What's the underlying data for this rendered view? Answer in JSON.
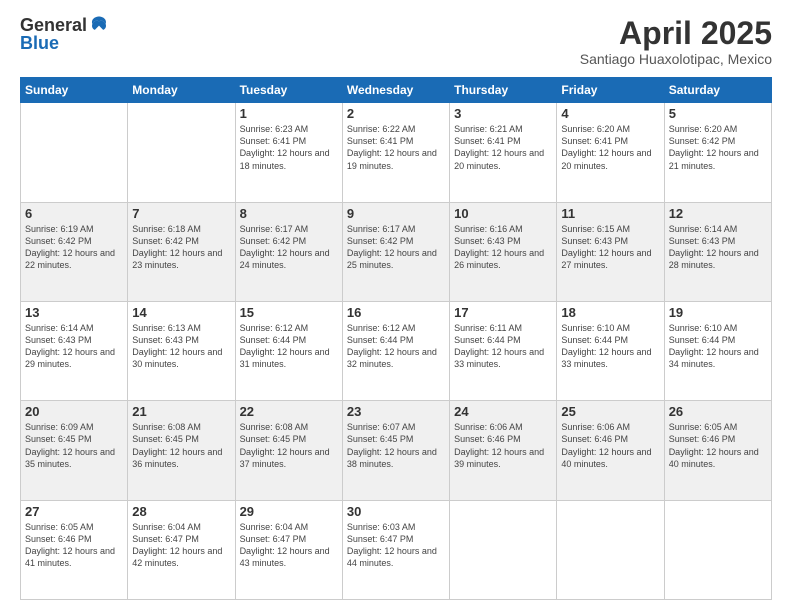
{
  "header": {
    "logo_general": "General",
    "logo_blue": "Blue",
    "month": "April 2025",
    "location": "Santiago Huaxolotipac, Mexico"
  },
  "days_of_week": [
    "Sunday",
    "Monday",
    "Tuesday",
    "Wednesday",
    "Thursday",
    "Friday",
    "Saturday"
  ],
  "weeks": [
    [
      {
        "day": "",
        "sunrise": "",
        "sunset": "",
        "daylight": ""
      },
      {
        "day": "",
        "sunrise": "",
        "sunset": "",
        "daylight": ""
      },
      {
        "day": "1",
        "sunrise": "Sunrise: 6:23 AM",
        "sunset": "Sunset: 6:41 PM",
        "daylight": "Daylight: 12 hours and 18 minutes."
      },
      {
        "day": "2",
        "sunrise": "Sunrise: 6:22 AM",
        "sunset": "Sunset: 6:41 PM",
        "daylight": "Daylight: 12 hours and 19 minutes."
      },
      {
        "day": "3",
        "sunrise": "Sunrise: 6:21 AM",
        "sunset": "Sunset: 6:41 PM",
        "daylight": "Daylight: 12 hours and 20 minutes."
      },
      {
        "day": "4",
        "sunrise": "Sunrise: 6:20 AM",
        "sunset": "Sunset: 6:41 PM",
        "daylight": "Daylight: 12 hours and 20 minutes."
      },
      {
        "day": "5",
        "sunrise": "Sunrise: 6:20 AM",
        "sunset": "Sunset: 6:42 PM",
        "daylight": "Daylight: 12 hours and 21 minutes."
      }
    ],
    [
      {
        "day": "6",
        "sunrise": "Sunrise: 6:19 AM",
        "sunset": "Sunset: 6:42 PM",
        "daylight": "Daylight: 12 hours and 22 minutes."
      },
      {
        "day": "7",
        "sunrise": "Sunrise: 6:18 AM",
        "sunset": "Sunset: 6:42 PM",
        "daylight": "Daylight: 12 hours and 23 minutes."
      },
      {
        "day": "8",
        "sunrise": "Sunrise: 6:17 AM",
        "sunset": "Sunset: 6:42 PM",
        "daylight": "Daylight: 12 hours and 24 minutes."
      },
      {
        "day": "9",
        "sunrise": "Sunrise: 6:17 AM",
        "sunset": "Sunset: 6:42 PM",
        "daylight": "Daylight: 12 hours and 25 minutes."
      },
      {
        "day": "10",
        "sunrise": "Sunrise: 6:16 AM",
        "sunset": "Sunset: 6:43 PM",
        "daylight": "Daylight: 12 hours and 26 minutes."
      },
      {
        "day": "11",
        "sunrise": "Sunrise: 6:15 AM",
        "sunset": "Sunset: 6:43 PM",
        "daylight": "Daylight: 12 hours and 27 minutes."
      },
      {
        "day": "12",
        "sunrise": "Sunrise: 6:14 AM",
        "sunset": "Sunset: 6:43 PM",
        "daylight": "Daylight: 12 hours and 28 minutes."
      }
    ],
    [
      {
        "day": "13",
        "sunrise": "Sunrise: 6:14 AM",
        "sunset": "Sunset: 6:43 PM",
        "daylight": "Daylight: 12 hours and 29 minutes."
      },
      {
        "day": "14",
        "sunrise": "Sunrise: 6:13 AM",
        "sunset": "Sunset: 6:43 PM",
        "daylight": "Daylight: 12 hours and 30 minutes."
      },
      {
        "day": "15",
        "sunrise": "Sunrise: 6:12 AM",
        "sunset": "Sunset: 6:44 PM",
        "daylight": "Daylight: 12 hours and 31 minutes."
      },
      {
        "day": "16",
        "sunrise": "Sunrise: 6:12 AM",
        "sunset": "Sunset: 6:44 PM",
        "daylight": "Daylight: 12 hours and 32 minutes."
      },
      {
        "day": "17",
        "sunrise": "Sunrise: 6:11 AM",
        "sunset": "Sunset: 6:44 PM",
        "daylight": "Daylight: 12 hours and 33 minutes."
      },
      {
        "day": "18",
        "sunrise": "Sunrise: 6:10 AM",
        "sunset": "Sunset: 6:44 PM",
        "daylight": "Daylight: 12 hours and 33 minutes."
      },
      {
        "day": "19",
        "sunrise": "Sunrise: 6:10 AM",
        "sunset": "Sunset: 6:44 PM",
        "daylight": "Daylight: 12 hours and 34 minutes."
      }
    ],
    [
      {
        "day": "20",
        "sunrise": "Sunrise: 6:09 AM",
        "sunset": "Sunset: 6:45 PM",
        "daylight": "Daylight: 12 hours and 35 minutes."
      },
      {
        "day": "21",
        "sunrise": "Sunrise: 6:08 AM",
        "sunset": "Sunset: 6:45 PM",
        "daylight": "Daylight: 12 hours and 36 minutes."
      },
      {
        "day": "22",
        "sunrise": "Sunrise: 6:08 AM",
        "sunset": "Sunset: 6:45 PM",
        "daylight": "Daylight: 12 hours and 37 minutes."
      },
      {
        "day": "23",
        "sunrise": "Sunrise: 6:07 AM",
        "sunset": "Sunset: 6:45 PM",
        "daylight": "Daylight: 12 hours and 38 minutes."
      },
      {
        "day": "24",
        "sunrise": "Sunrise: 6:06 AM",
        "sunset": "Sunset: 6:46 PM",
        "daylight": "Daylight: 12 hours and 39 minutes."
      },
      {
        "day": "25",
        "sunrise": "Sunrise: 6:06 AM",
        "sunset": "Sunset: 6:46 PM",
        "daylight": "Daylight: 12 hours and 40 minutes."
      },
      {
        "day": "26",
        "sunrise": "Sunrise: 6:05 AM",
        "sunset": "Sunset: 6:46 PM",
        "daylight": "Daylight: 12 hours and 40 minutes."
      }
    ],
    [
      {
        "day": "27",
        "sunrise": "Sunrise: 6:05 AM",
        "sunset": "Sunset: 6:46 PM",
        "daylight": "Daylight: 12 hours and 41 minutes."
      },
      {
        "day": "28",
        "sunrise": "Sunrise: 6:04 AM",
        "sunset": "Sunset: 6:47 PM",
        "daylight": "Daylight: 12 hours and 42 minutes."
      },
      {
        "day": "29",
        "sunrise": "Sunrise: 6:04 AM",
        "sunset": "Sunset: 6:47 PM",
        "daylight": "Daylight: 12 hours and 43 minutes."
      },
      {
        "day": "30",
        "sunrise": "Sunrise: 6:03 AM",
        "sunset": "Sunset: 6:47 PM",
        "daylight": "Daylight: 12 hours and 44 minutes."
      },
      {
        "day": "",
        "sunrise": "",
        "sunset": "",
        "daylight": ""
      },
      {
        "day": "",
        "sunrise": "",
        "sunset": "",
        "daylight": ""
      },
      {
        "day": "",
        "sunrise": "",
        "sunset": "",
        "daylight": ""
      }
    ]
  ]
}
